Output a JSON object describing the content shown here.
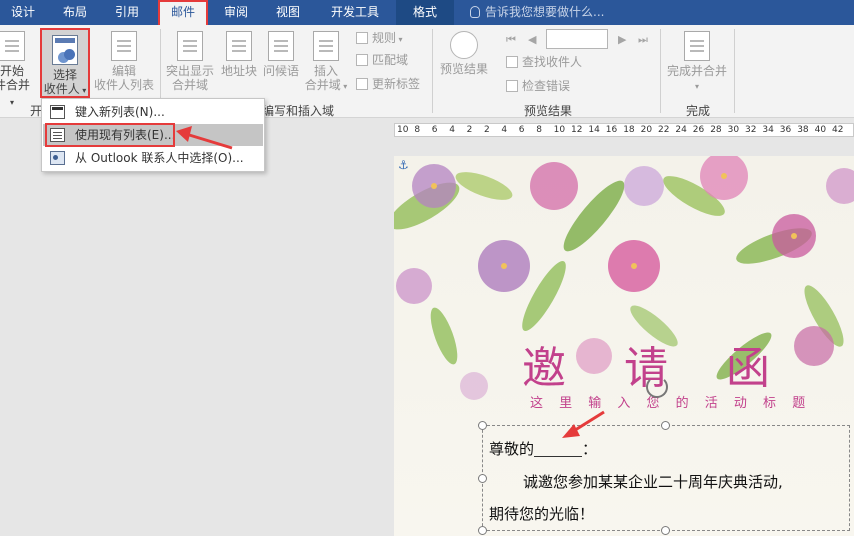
{
  "tabs": {
    "design": "设计",
    "layout": "布局",
    "references": "引用",
    "mailings": "邮件",
    "review": "审阅",
    "view": "视图",
    "developer": "开发工具",
    "format": "格式"
  },
  "tell_me": "告诉我您想要做什么...",
  "ribbon": {
    "start_merge_line1": "开始",
    "start_merge_line2": "件合并",
    "select_recipients_line1": "选择",
    "select_recipients_line2": "收件人",
    "edit_recipients_line1": "编辑",
    "edit_recipients_line2": "收件人列表",
    "highlight_fields_line1": "突出显示",
    "highlight_fields_line2": "合并域",
    "address_block": "地址块",
    "greeting_line": "问候语",
    "insert_field_line1": "插入",
    "insert_field_line2": "合并域",
    "rules": "规则",
    "match_fields": "匹配域",
    "update_labels": "更新标签",
    "preview_results": "预览结果",
    "find_recipient": "查找收件人",
    "check_errors": "检查错误",
    "finish_merge": "完成并合并",
    "group_start_partial": "开",
    "group_write_insert_partial": "编写和插入域",
    "group_preview": "预览结果",
    "group_finish": "完成"
  },
  "dropdown": {
    "type_new_list": "键入新列表(N)...",
    "use_existing_list": "使用现有列表(E)...",
    "choose_outlook": "从 Outlook 联系人中选择(O)..."
  },
  "ruler": [
    "10",
    "8",
    "6",
    "4",
    "2",
    "2",
    "4",
    "6",
    "8",
    "10",
    "12",
    "14",
    "16",
    "18",
    "20",
    "22",
    "24",
    "26",
    "28",
    "30",
    "32",
    "34",
    "36",
    "38",
    "40",
    "42"
  ],
  "document": {
    "title": "邀 请 函",
    "subtitle": "这 里 输 入 您 的 活 动 标 题",
    "salutation": "尊敬的",
    "salutation_end": "：",
    "body_line1": "诚邀您参加某某企业二十周年庆典活动,",
    "body_line2": "期待您的光临！"
  },
  "colors": {
    "accent": "#2b579a",
    "highlight_red": "#e53b3b",
    "title_pink": "#c2418c"
  }
}
